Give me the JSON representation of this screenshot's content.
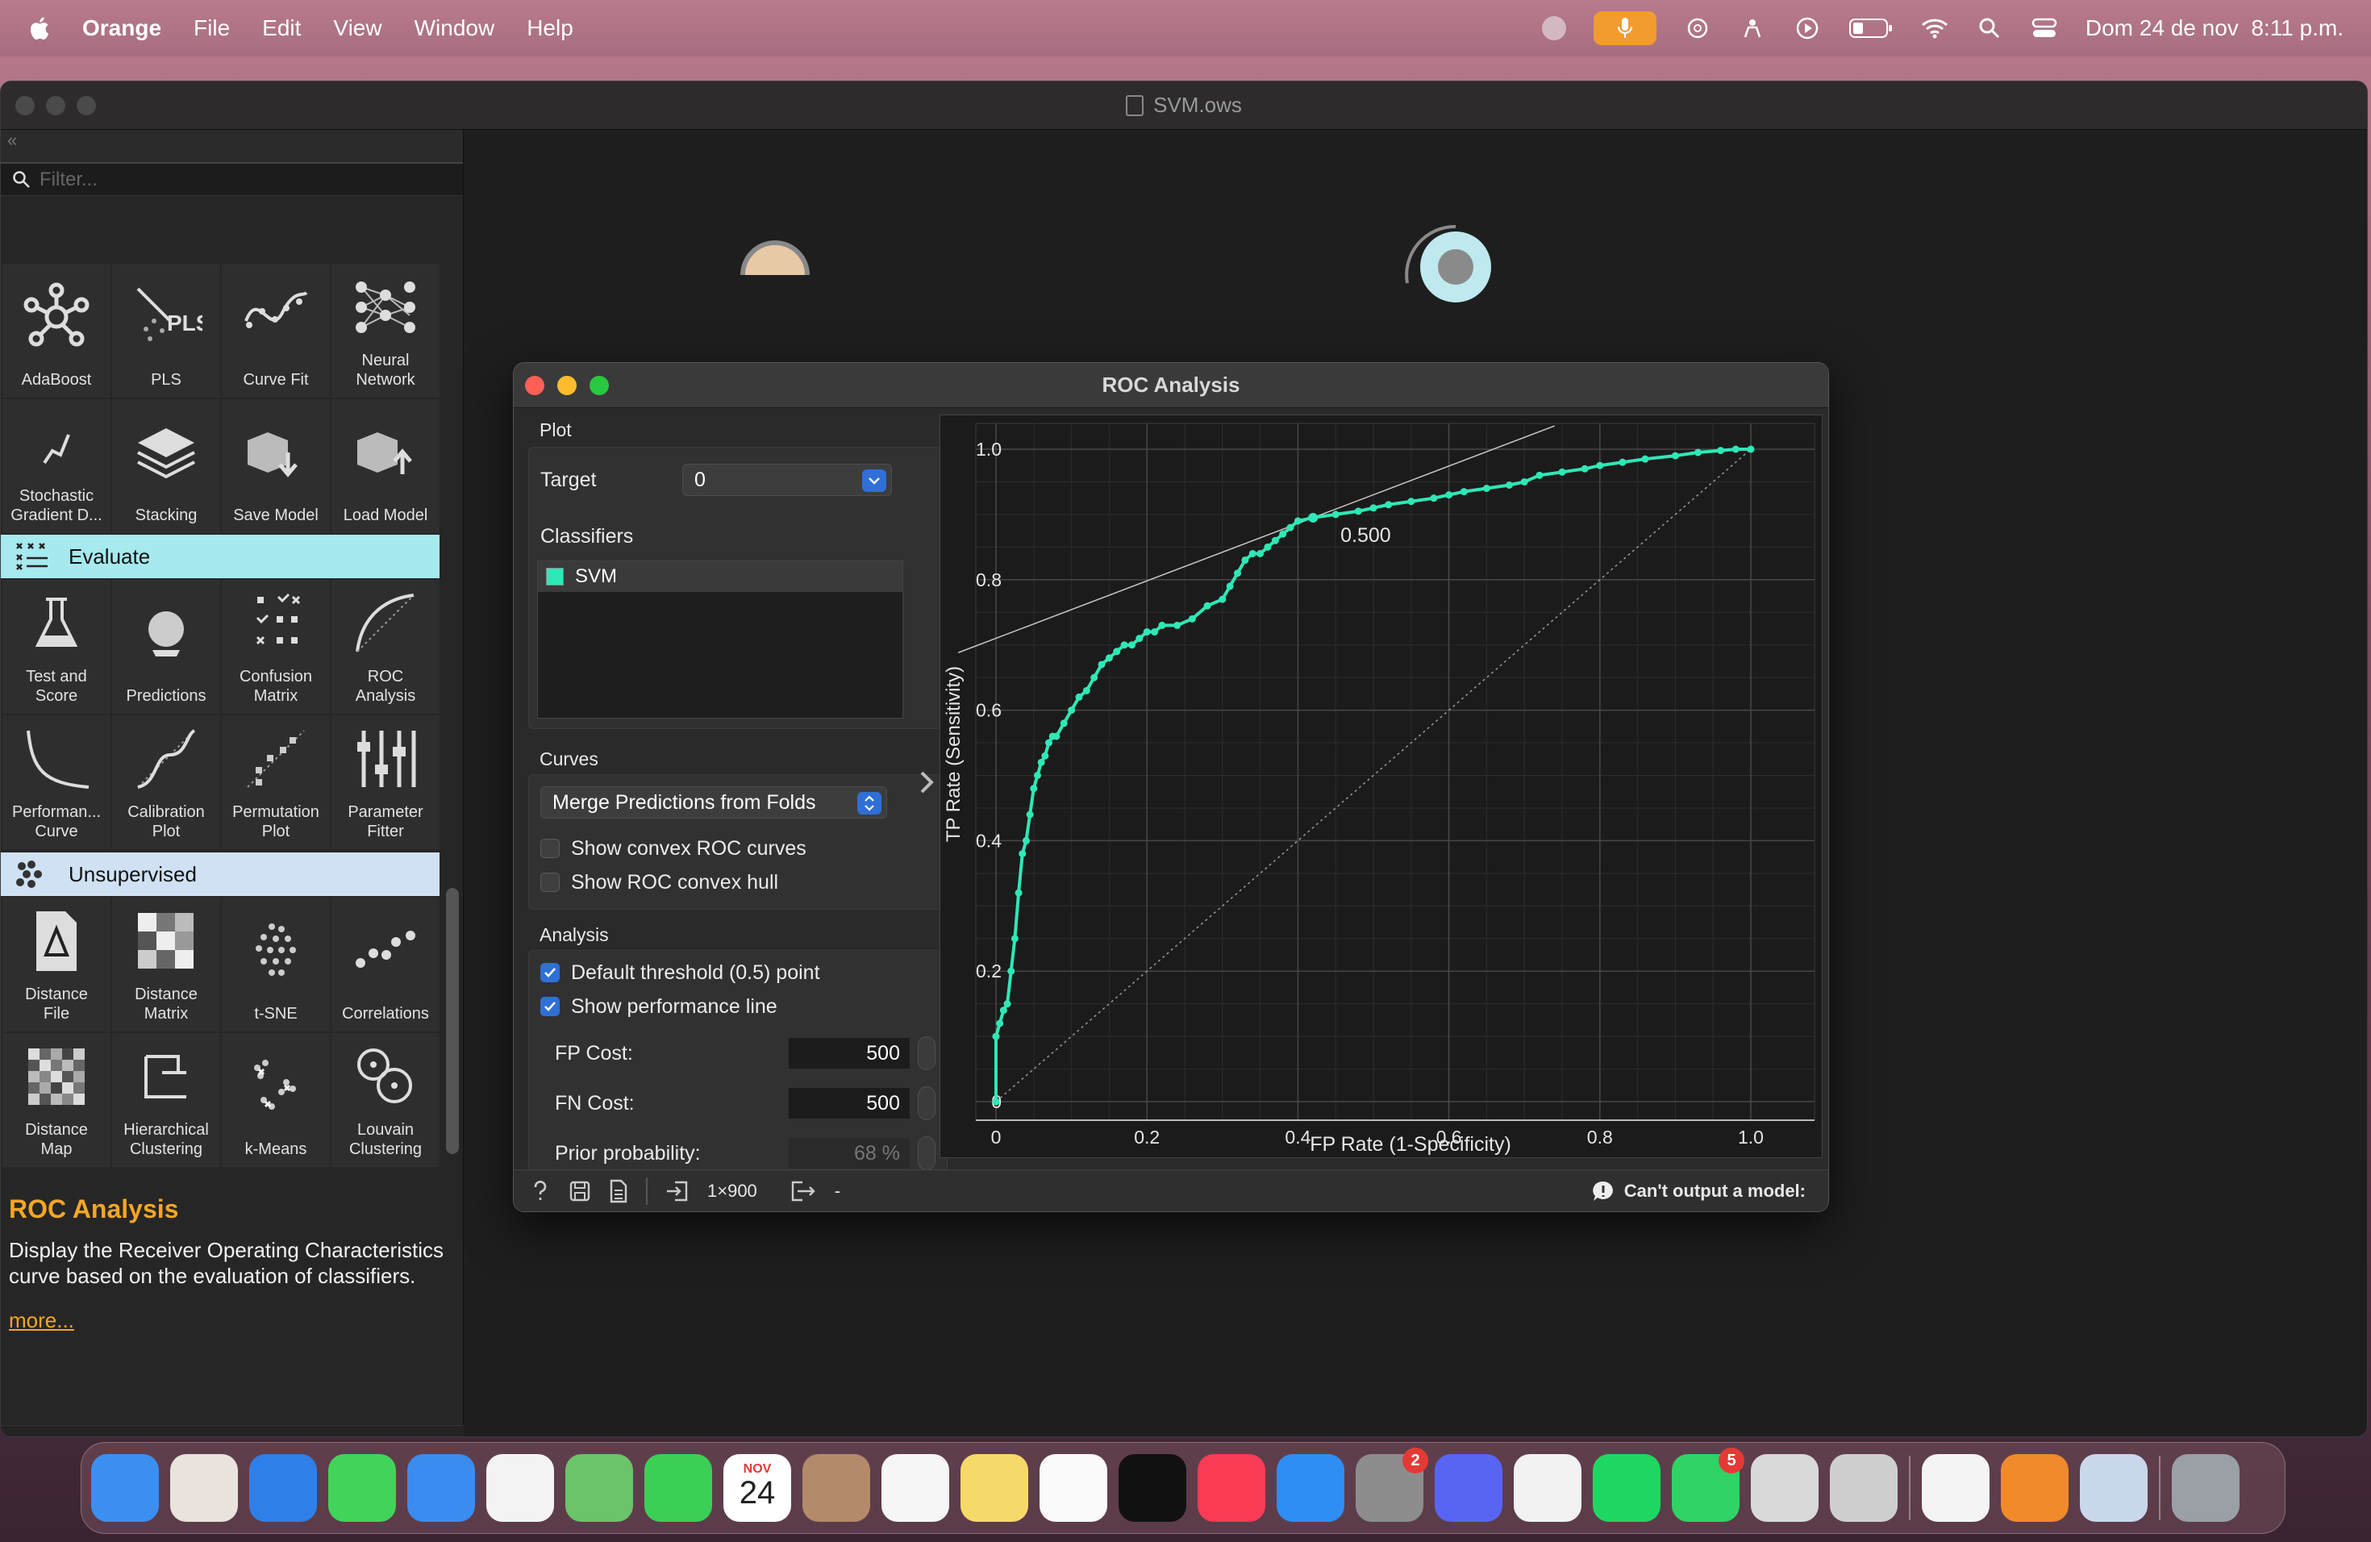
{
  "menubar": {
    "app_name": "Orange",
    "menus": [
      "File",
      "Edit",
      "View",
      "Window",
      "Help"
    ],
    "clock": "Dom 24 de nov  8:11 p.m."
  },
  "window": {
    "title": "SVM.ows"
  },
  "toolbox": {
    "filter_placeholder": "Filter...",
    "model_row1": [
      {
        "label": "AdaBoost",
        "icon": "adaboost-icon"
      },
      {
        "label": "PLS",
        "icon": "pls-icon"
      },
      {
        "label": "Curve Fit",
        "icon": "curve-fit-icon"
      },
      {
        "label": "Neural Network",
        "icon": "neural-network-icon"
      }
    ],
    "model_row2": [
      {
        "label": "Stochastic Gradient D...",
        "icon": "sgd-icon"
      },
      {
        "label": "Stacking",
        "icon": "stacking-icon"
      },
      {
        "label": "Save Model",
        "icon": "save-model-icon"
      },
      {
        "label": "Load Model",
        "icon": "load-model-icon"
      }
    ],
    "evaluate_header": "Evaluate",
    "eval_row1": [
      {
        "label": "Test and Score",
        "icon": "test-score-icon"
      },
      {
        "label": "Predictions",
        "icon": "predictions-icon"
      },
      {
        "label": "Confusion Matrix",
        "icon": "confusion-matrix-icon"
      },
      {
        "label": "ROC Analysis",
        "icon": "roc-analysis-icon"
      }
    ],
    "eval_row2": [
      {
        "label": "Performan... Curve",
        "icon": "performance-curve-icon"
      },
      {
        "label": "Calibration Plot",
        "icon": "calibration-plot-icon"
      },
      {
        "label": "Permutation Plot",
        "icon": "permutation-plot-icon"
      },
      {
        "label": "Parameter Fitter",
        "icon": "parameter-fitter-icon"
      }
    ],
    "unsupervised_header": "Unsupervised",
    "unsup_row1": [
      {
        "label": "Distance File",
        "icon": "distance-file-icon"
      },
      {
        "label": "Distance Matrix",
        "icon": "distance-matrix-icon"
      },
      {
        "label": "t-SNE",
        "icon": "tsne-icon"
      },
      {
        "label": "Correlations",
        "icon": "correlations-icon"
      }
    ],
    "unsup_row2": [
      {
        "label": "Distance Map",
        "icon": "distance-map-icon"
      },
      {
        "label": "Hierarchical Clustering",
        "icon": "hierarchical-clustering-icon"
      },
      {
        "label": "k-Means",
        "icon": "kmeans-icon"
      },
      {
        "label": "Louvain Clustering",
        "icon": "louvain-clustering-icon"
      }
    ]
  },
  "help": {
    "title": "ROC Analysis",
    "description": "Display the Receiver Operating Characteristics curve based on the evaluation of classifiers.",
    "more": "more..."
  },
  "roc": {
    "title": "ROC Analysis",
    "plot_group": "Plot",
    "target_label": "Target",
    "target_value": "0",
    "classifiers_label": "Classifiers",
    "classifier_item": "SVM",
    "classifier_color": "#2ee8b6",
    "curves_group": "Curves",
    "curves_mode": "Merge Predictions from Folds",
    "show_convex_curves": "Show convex ROC curves",
    "show_convex_hull": "Show ROC convex hull",
    "analysis_group": "Analysis",
    "default_threshold": "Default threshold (0.5) point",
    "show_perf_line": "Show performance line",
    "fp_cost_label": "FP Cost:",
    "fp_cost": "500",
    "fn_cost_label": "FN Cost:",
    "fn_cost": "500",
    "prior_label": "Prior probability:",
    "prior": "68 %",
    "status_size": "1×900",
    "status_out": "-",
    "status_warning": "Can't output a model:"
  },
  "chart_data": {
    "type": "line",
    "xlabel": "FP Rate (1-Specificity)",
    "ylabel": "TP Rate (Sensitivity)",
    "xlim": [
      0,
      1
    ],
    "ylim": [
      0,
      1
    ],
    "xticks": [
      "0",
      "0.2",
      "0.4",
      "0.6",
      "0.8",
      "1.0"
    ],
    "yticks": [
      "0",
      "0.2",
      "0.4",
      "0.6",
      "0.8",
      "1.0"
    ],
    "grid": true,
    "threshold_label": "0.500",
    "threshold_point": [
      0.42,
      0.895
    ],
    "series": [
      {
        "name": "SVM",
        "color": "#2ee8b6",
        "x": [
          0,
          0,
          0.005,
          0.01,
          0.015,
          0.02,
          0.025,
          0.03,
          0.035,
          0.04,
          0.045,
          0.05,
          0.055,
          0.06,
          0.065,
          0.07,
          0.075,
          0.08,
          0.09,
          0.1,
          0.11,
          0.12,
          0.13,
          0.14,
          0.15,
          0.16,
          0.17,
          0.18,
          0.19,
          0.2,
          0.21,
          0.22,
          0.24,
          0.26,
          0.28,
          0.3,
          0.31,
          0.32,
          0.33,
          0.34,
          0.35,
          0.36,
          0.37,
          0.38,
          0.39,
          0.4,
          0.42,
          0.45,
          0.48,
          0.5,
          0.52,
          0.55,
          0.58,
          0.6,
          0.62,
          0.65,
          0.68,
          0.7,
          0.72,
          0.75,
          0.78,
          0.8,
          0.83,
          0.86,
          0.9,
          0.93,
          0.96,
          0.98,
          1.0
        ],
        "y": [
          0,
          0.1,
          0.12,
          0.14,
          0.15,
          0.2,
          0.25,
          0.32,
          0.38,
          0.4,
          0.44,
          0.48,
          0.5,
          0.52,
          0.53,
          0.55,
          0.56,
          0.56,
          0.58,
          0.6,
          0.62,
          0.63,
          0.65,
          0.67,
          0.68,
          0.69,
          0.7,
          0.7,
          0.71,
          0.72,
          0.72,
          0.73,
          0.73,
          0.74,
          0.76,
          0.77,
          0.79,
          0.81,
          0.83,
          0.84,
          0.84,
          0.85,
          0.86,
          0.87,
          0.88,
          0.89,
          0.895,
          0.9,
          0.905,
          0.91,
          0.915,
          0.92,
          0.925,
          0.93,
          0.935,
          0.94,
          0.945,
          0.95,
          0.96,
          0.965,
          0.97,
          0.975,
          0.98,
          0.985,
          0.99,
          0.995,
          0.998,
          1.0,
          1.0
        ]
      }
    ]
  },
  "dock": {
    "apps": [
      {
        "name": "finder",
        "color": "#3b8ff1"
      },
      {
        "name": "launchpad",
        "color": "#e9e2dd"
      },
      {
        "name": "safari",
        "color": "#2f7fe8"
      },
      {
        "name": "messages",
        "color": "#42d35a"
      },
      {
        "name": "mail",
        "color": "#3a8cf0"
      },
      {
        "name": "photos",
        "color": "#f3f3f3"
      },
      {
        "name": "maps",
        "color": "#6bc36a"
      },
      {
        "name": "facetime",
        "color": "#3ccf55"
      },
      {
        "name": "calendar",
        "color": "#ffffff"
      },
      {
        "name": "contacts",
        "color": "#b48a6a"
      },
      {
        "name": "reminders",
        "color": "#f6f6f6"
      },
      {
        "name": "notes",
        "color": "#f7d96a"
      },
      {
        "name": "freeform",
        "color": "#fafafa"
      },
      {
        "name": "apple-tv",
        "color": "#111111"
      },
      {
        "name": "music",
        "color": "#fa3c55"
      },
      {
        "name": "app-store",
        "color": "#2e8ef3"
      },
      {
        "name": "system-settings",
        "color": "#8d8d8d"
      },
      {
        "name": "discord",
        "color": "#5865f2"
      },
      {
        "name": "chrome",
        "color": "#f2f2f2"
      },
      {
        "name": "spotify",
        "color": "#1ed760"
      },
      {
        "name": "whatsapp",
        "color": "#2fd366"
      },
      {
        "name": "roblox",
        "color": "#d9d9d9"
      },
      {
        "name": "iphone-mirroring",
        "color": "#cfcfcf"
      },
      {
        "name": "chatgpt",
        "color": "#f4f4f4"
      },
      {
        "name": "orange",
        "color": "#f08a2a"
      },
      {
        "name": "preview",
        "color": "#c9d8ea"
      },
      {
        "name": "trash",
        "color": "#9aa0a6"
      }
    ],
    "calendar_month": "NOV",
    "calendar_day": "24",
    "settings_badge": "2",
    "whatsapp_badge": "5"
  }
}
